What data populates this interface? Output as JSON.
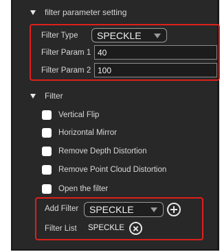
{
  "filter_param_section": {
    "title": "filter parameter setting",
    "filter_type_label": "Filter Type",
    "filter_type_value": "SPECKLE",
    "param1_label": "Filter Param 1",
    "param1_value": "40",
    "param2_label": "Filter Param 2",
    "param2_value": "100"
  },
  "filter_section": {
    "title": "Filter",
    "checkboxes": [
      {
        "label": "Vertical Flip",
        "checked": false
      },
      {
        "label": "Horizontal Mirror",
        "checked": false
      },
      {
        "label": "Remove Depth Distortion",
        "checked": false
      },
      {
        "label": "Remove Point Cloud Distortion",
        "checked": false
      },
      {
        "label": "Open the filter",
        "checked": false
      }
    ],
    "add_filter_label": "Add Filter",
    "add_filter_value": "SPECKLE",
    "filter_list_label": "Filter List",
    "filter_list_items": [
      "SPECKLE"
    ]
  },
  "icons": {
    "expand": "triangle-down-icon",
    "dropdown": "chevron-down-icon",
    "add": "plus-circle-icon",
    "remove": "close-circle-icon"
  },
  "colors": {
    "panel_bg": "#282828",
    "highlight_border": "#e0201b",
    "text": "#d8d8d8"
  }
}
